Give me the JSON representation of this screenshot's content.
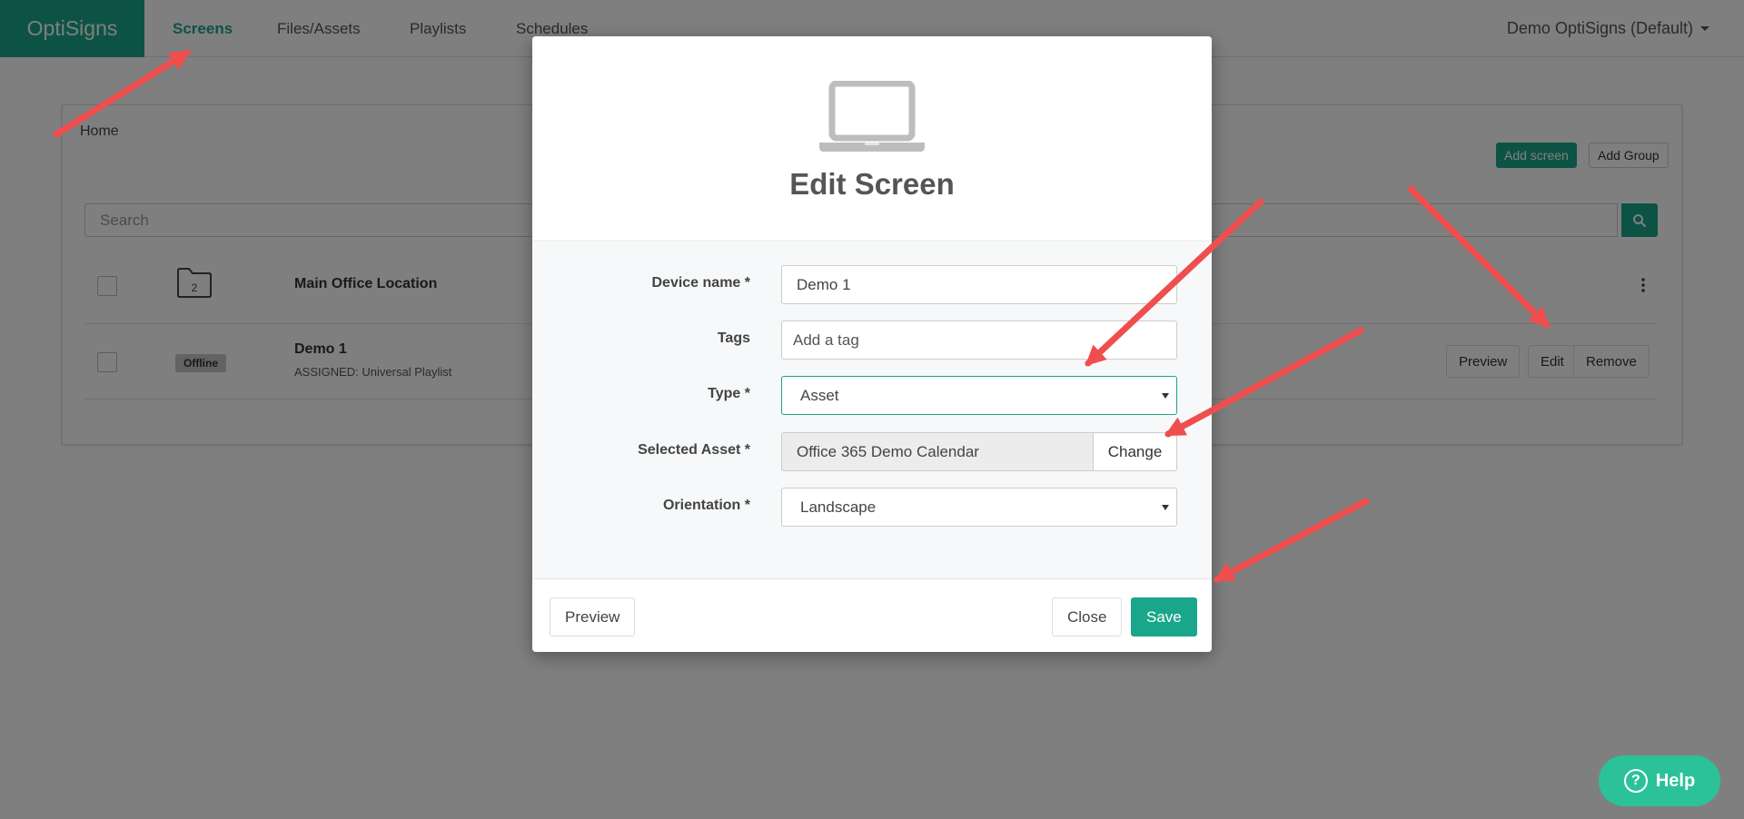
{
  "navbar": {
    "brand": "OptiSigns",
    "items": [
      {
        "label": "Screens",
        "active": true
      },
      {
        "label": "Files/Assets",
        "active": false
      },
      {
        "label": "Playlists",
        "active": false
      },
      {
        "label": "Schedules",
        "active": false
      }
    ],
    "account": "Demo OptiSigns (Default)"
  },
  "page": {
    "breadcrumb": "Home",
    "add_screen": "Add screen",
    "add_group": "Add Group",
    "search_placeholder": "Search",
    "rows": [
      {
        "title": "Main Office Location",
        "folder_count": "2"
      },
      {
        "title": "Demo 1",
        "status": "Offline",
        "subtitle": "ASSIGNED: Universal Playlist",
        "actions": [
          "Preview",
          "Edit",
          "Remove"
        ]
      }
    ]
  },
  "modal": {
    "title": "Edit Screen",
    "fields": {
      "device_name": {
        "label": "Device name *",
        "value": "Demo 1"
      },
      "tags": {
        "label": "Tags",
        "placeholder": "Add a tag"
      },
      "type": {
        "label": "Type *",
        "value": "Asset"
      },
      "selected_asset": {
        "label": "Selected Asset *",
        "value": "Office 365 Demo Calendar",
        "change_label": "Change"
      },
      "orientation": {
        "label": "Orientation *",
        "value": "Landscape"
      }
    },
    "footer": {
      "preview": "Preview",
      "close": "Close",
      "save": "Save"
    }
  },
  "help": {
    "label": "Help",
    "icon": "question-circle-icon"
  },
  "colors": {
    "brand": "#1aa68a",
    "help": "#2bc29a",
    "annotation_arrow": "#f04e4e"
  }
}
